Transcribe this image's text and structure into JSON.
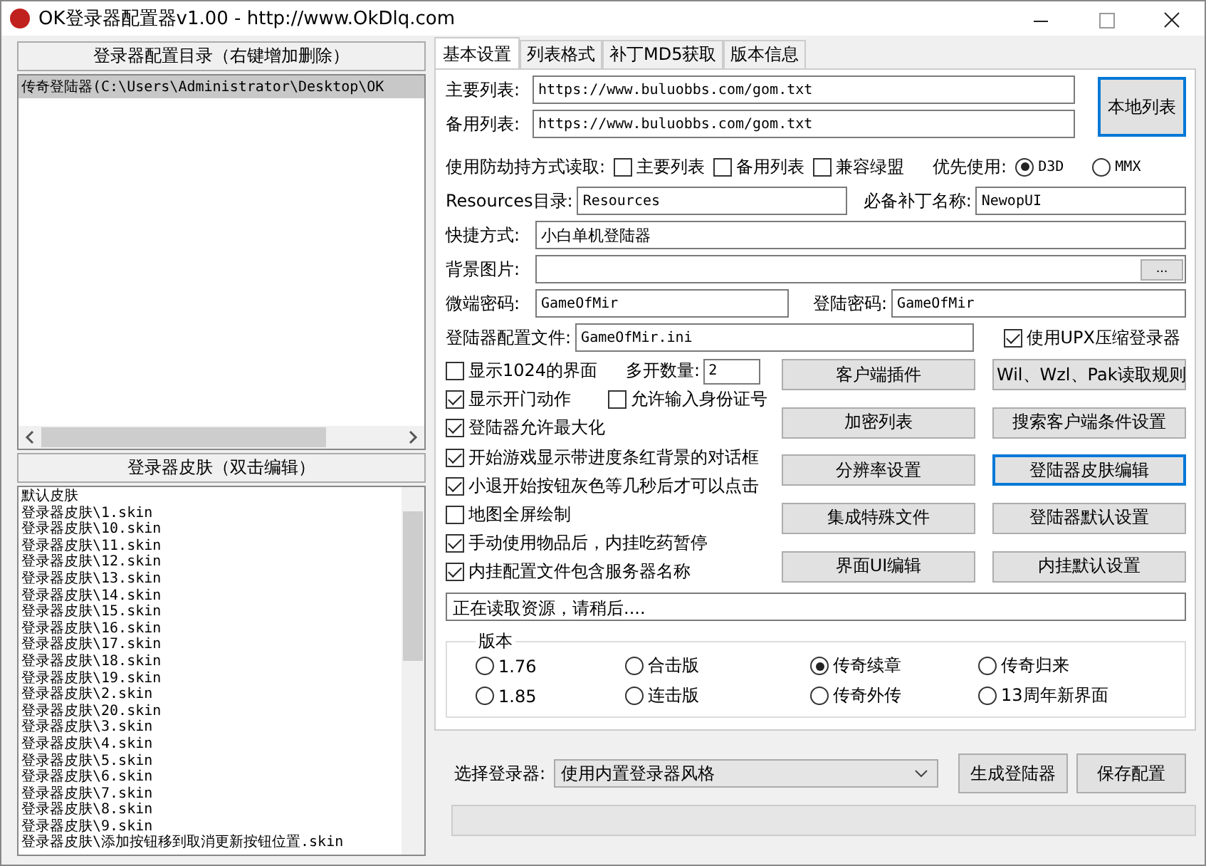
{
  "window": {
    "title": "OK登录器配置器v1.00 - http://www.OkDlq.com"
  },
  "config_list": {
    "header": "登录器配置目录（右键增加删除）",
    "items": [
      {
        "text": "传奇登陆器(C:\\Users\\Administrator\\Desktop\\OK",
        "selected": true
      }
    ]
  },
  "skin_list": {
    "header": "登录器皮肤（双击编辑）",
    "items": [
      "默认皮肤",
      "登录器皮肤\\1.skin",
      "登录器皮肤\\10.skin",
      "登录器皮肤\\11.skin",
      "登录器皮肤\\12.skin",
      "登录器皮肤\\13.skin",
      "登录器皮肤\\14.skin",
      "登录器皮肤\\15.skin",
      "登录器皮肤\\16.skin",
      "登录器皮肤\\17.skin",
      "登录器皮肤\\18.skin",
      "登录器皮肤\\19.skin",
      "登录器皮肤\\2.skin",
      "登录器皮肤\\20.skin",
      "登录器皮肤\\3.skin",
      "登录器皮肤\\4.skin",
      "登录器皮肤\\5.skin",
      "登录器皮肤\\6.skin",
      "登录器皮肤\\7.skin",
      "登录器皮肤\\8.skin",
      "登录器皮肤\\9.skin",
      "登录器皮肤\\添加按钮移到取消更新按钮位置.skin"
    ]
  },
  "tabs": [
    {
      "label": "基本设置",
      "selected": true
    },
    {
      "label": "列表格式",
      "selected": false
    },
    {
      "label": "补丁MD5获取",
      "selected": false
    },
    {
      "label": "版本信息",
      "selected": false
    }
  ],
  "primary_list": {
    "label": "主要列表:",
    "value": "https://www.buluobbs.com/gom.txt"
  },
  "backup_list": {
    "label": "备用列表:",
    "value": "https://www.buluobbs.com/gom.txt"
  },
  "local_list_button": {
    "label": "本地列表",
    "focused": true
  },
  "anti_hijack": {
    "label": "使用防劫持方式读取:",
    "options": [
      {
        "label": "主要列表",
        "checked": false
      },
      {
        "label": "备用列表",
        "checked": false
      },
      {
        "label": "兼容绿盟",
        "checked": false
      }
    ]
  },
  "priority": {
    "label": "优先使用:",
    "options": [
      {
        "label": "D3D",
        "selected": true
      },
      {
        "label": "MMX",
        "selected": false
      }
    ]
  },
  "resources_dir": {
    "label": "Resources目录:",
    "value": "Resources"
  },
  "patch_name": {
    "label": "必备补丁名称:",
    "value": "NewopUI"
  },
  "shortcut": {
    "label": "快捷方式:",
    "value": "小白单机登陆器"
  },
  "background": {
    "label": "背景图片:",
    "button": "..."
  },
  "micro_password": {
    "label": "微端密码:",
    "value": "GameOfMir"
  },
  "login_password": {
    "label": "登陆密码:",
    "value": "GameOfMir"
  },
  "config_file": {
    "label": "登陆器配置文件:",
    "value": "GameOfMir.ini"
  },
  "upx": {
    "label": "使用UPX压缩登录器",
    "checked": true
  },
  "options": [
    [
      {
        "kind": "check",
        "label": "显示1024的界面",
        "checked": false
      },
      {
        "kind": "spin",
        "label": "多开数量:",
        "value": "2"
      }
    ],
    [
      {
        "kind": "check",
        "label": "显示开门动作",
        "checked": true
      },
      {
        "kind": "check",
        "label": "允许输入身份证号",
        "checked": false
      }
    ],
    [
      {
        "kind": "check",
        "label": "登陆器允许最大化",
        "checked": true
      }
    ],
    [
      {
        "kind": "check",
        "label": "开始游戏显示带进度条红背景的对话框",
        "checked": true
      }
    ],
    [
      {
        "kind": "check",
        "label": "小退开始按钮灰色等几秒后才可以点击",
        "checked": true
      }
    ],
    [
      {
        "kind": "check",
        "label": "地图全屏绘制",
        "checked": false
      }
    ],
    [
      {
        "kind": "check",
        "label": "手动使用物品后，内挂吃药暂停",
        "checked": true
      }
    ],
    [
      {
        "kind": "check",
        "label": "内挂配置文件包含服务器名称",
        "checked": true
      }
    ]
  ],
  "buttons": [
    {
      "label": "客户端插件",
      "focused": false
    },
    {
      "label": "Wil、Wzl、Pak读取规则",
      "focused": false
    },
    {
      "label": "加密列表",
      "focused": false
    },
    {
      "label": "搜索客户端条件设置",
      "focused": false
    },
    {
      "label": "分辨率设置",
      "focused": false
    },
    {
      "label": "登陆器皮肤编辑",
      "focused": true
    },
    {
      "label": "集成特殊文件",
      "focused": false
    },
    {
      "label": "登陆器默认设置",
      "focused": false
    },
    {
      "label": "界面UI编辑",
      "focused": false
    },
    {
      "label": "内挂默认设置",
      "focused": false
    }
  ],
  "status": "正在读取资源，请稍后....",
  "version": {
    "label": "版本",
    "options": [
      {
        "label": "1.76",
        "selected": false
      },
      {
        "label": "合击版",
        "selected": false
      },
      {
        "label": "传奇续章",
        "selected": true
      },
      {
        "label": "传奇归来",
        "selected": false
      },
      {
        "label": "1.85",
        "selected": false
      },
      {
        "label": "连击版",
        "selected": false
      },
      {
        "label": "传奇外传",
        "selected": false
      },
      {
        "label": "13周年新界面",
        "selected": false
      }
    ]
  },
  "select_launcher": {
    "label": "选择登录器:",
    "value": "使用内置登录器风格"
  },
  "generate_button": "生成登陆器",
  "save_button": "保存配置",
  "progress": {
    "level": 0
  }
}
